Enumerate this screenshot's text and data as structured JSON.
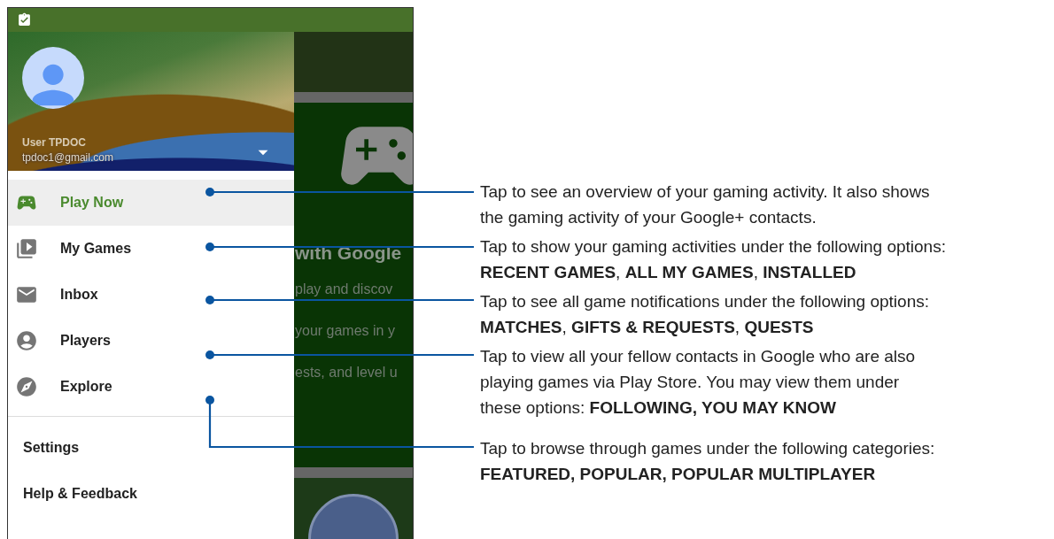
{
  "account": {
    "name": "User TPDOC",
    "email": "tpdoc1@gmail.com"
  },
  "menu": [
    {
      "label": "Play Now",
      "selected": true
    },
    {
      "label": "My Games",
      "selected": false
    },
    {
      "label": "Inbox",
      "selected": false
    },
    {
      "label": "Players",
      "selected": false
    },
    {
      "label": "Explore",
      "selected": false
    }
  ],
  "footer_menu": [
    "Settings",
    "Help & Feedback"
  ],
  "background_screen": {
    "heading": "with Google",
    "lines": [
      "play and discov",
      "your games in y",
      "ests, and level u"
    ]
  },
  "callouts": [
    "Tap to see an overview of your gaming activity. It also shows\nthe gaming activity of your Google+ contacts.",
    "Tap to show your gaming activities under the following options:\n**RECENT GAMES**, **ALL MY GAMES**, **INSTALLED**",
    "Tap to see all game notifications under the following options:\n**MATCHES**, **GIFTS & REQUESTS**, **QUESTS**",
    "Tap to view all your fellow contacts in Google who are also\nplaying games via Play Store. You may view them under\nthese options: **FOLLOWING, YOU MAY KNOW**",
    "Tap to browse through games under the following categories:\n**FEATURED, POPULAR, POPULAR MULTIPLAYER**"
  ]
}
